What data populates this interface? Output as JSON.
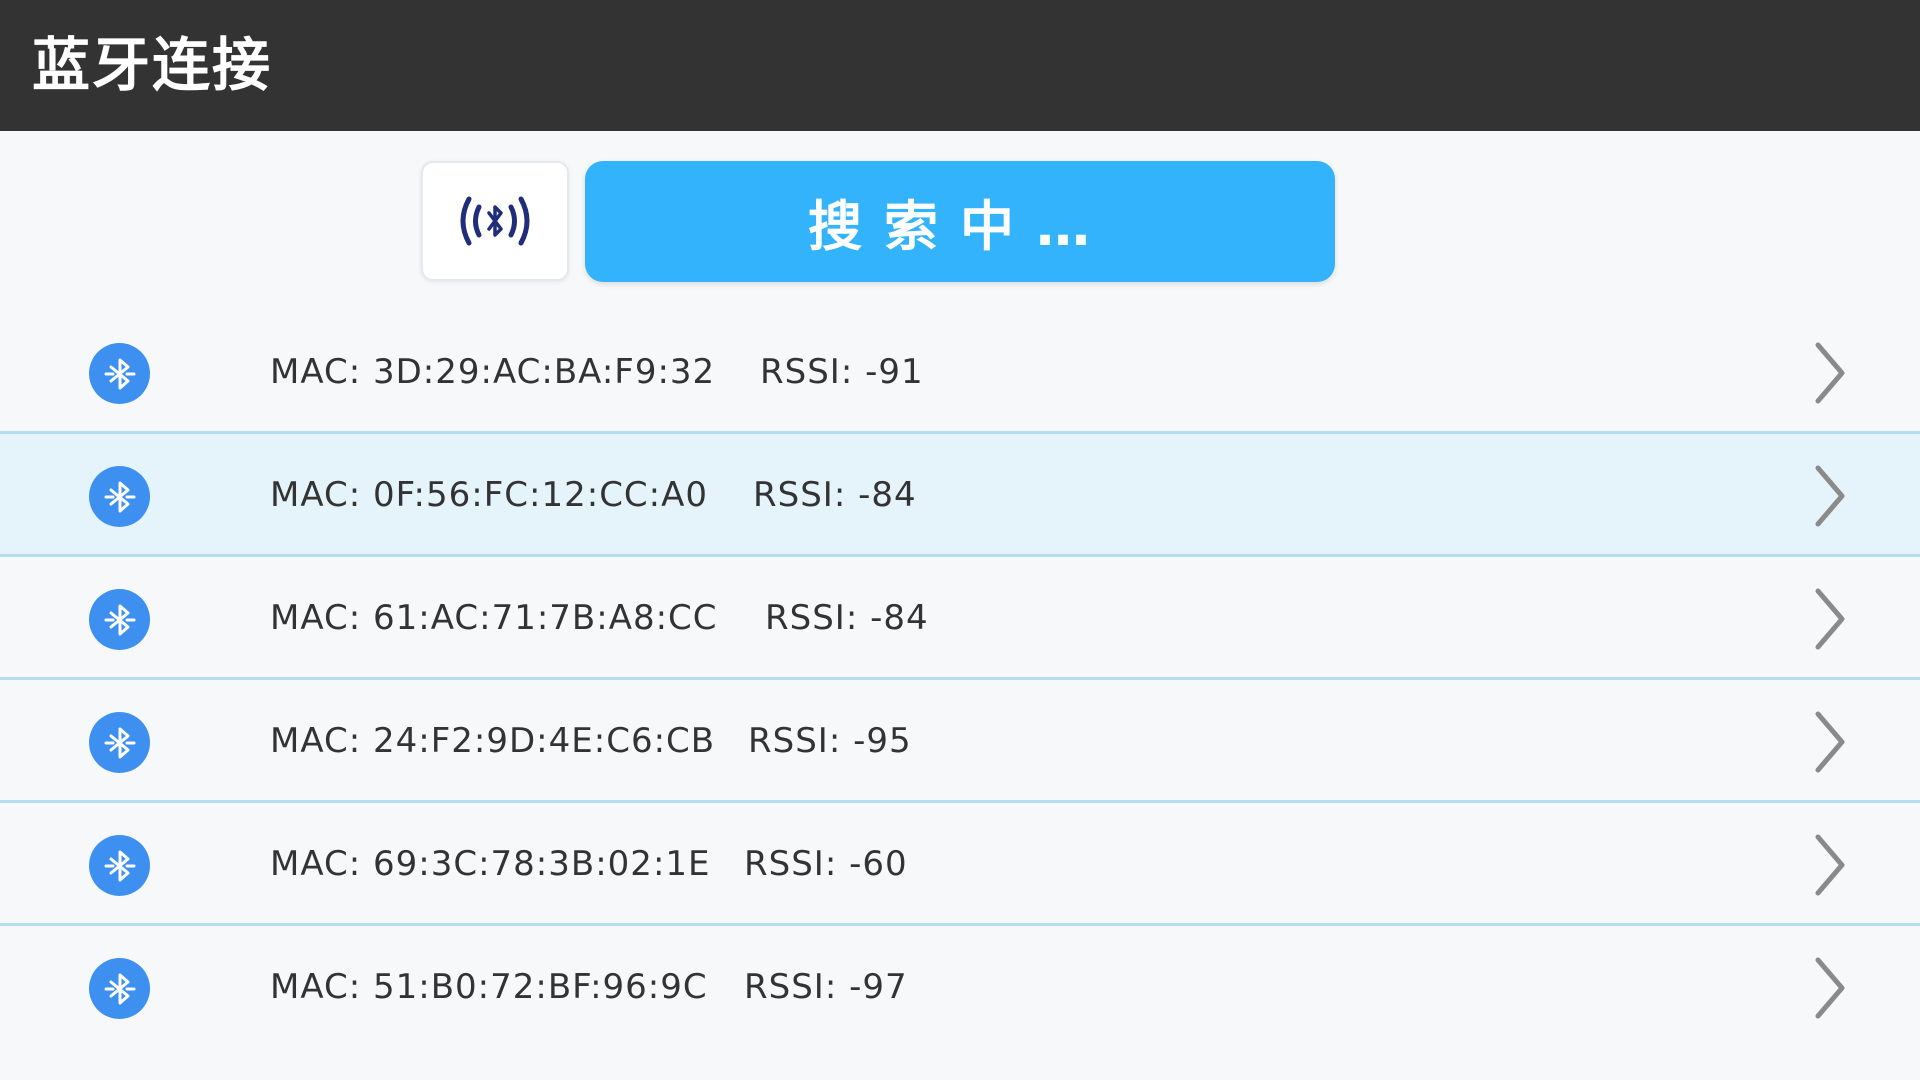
{
  "header": {
    "title": "蓝牙连接"
  },
  "toolbar": {
    "scan_icon": "bluetooth-broadcast-icon",
    "search_label": "搜索中…"
  },
  "devices": [
    {
      "mac": "MAC: 3D:29:AC:BA:F9:32",
      "rssi": "RSSI: -91",
      "selected": false
    },
    {
      "mac": "MAC: 0F:56:FC:12:CC:A0",
      "rssi": "RSSI: -84",
      "selected": true
    },
    {
      "mac": "MAC: 61:AC:71:7B:A8:CC",
      "rssi": "RSSI: -84",
      "selected": false
    },
    {
      "mac": "MAC: 24:F2:9D:4E:C6:CB",
      "rssi": "RSSI: -95",
      "selected": false
    },
    {
      "mac": "MAC: 69:3C:78:3B:02:1E",
      "rssi": "RSSI: -60",
      "selected": false
    },
    {
      "mac": "MAC: 51:B0:72:BF:96:9C",
      "rssi": "RSSI: -97",
      "selected": false
    }
  ],
  "colors": {
    "header_bg": "#333333",
    "accent": "#33b3fb",
    "bluetooth_icon": "#3d8ff0",
    "selected_row": "#e5f3fb",
    "divider": "#b5dcef"
  }
}
